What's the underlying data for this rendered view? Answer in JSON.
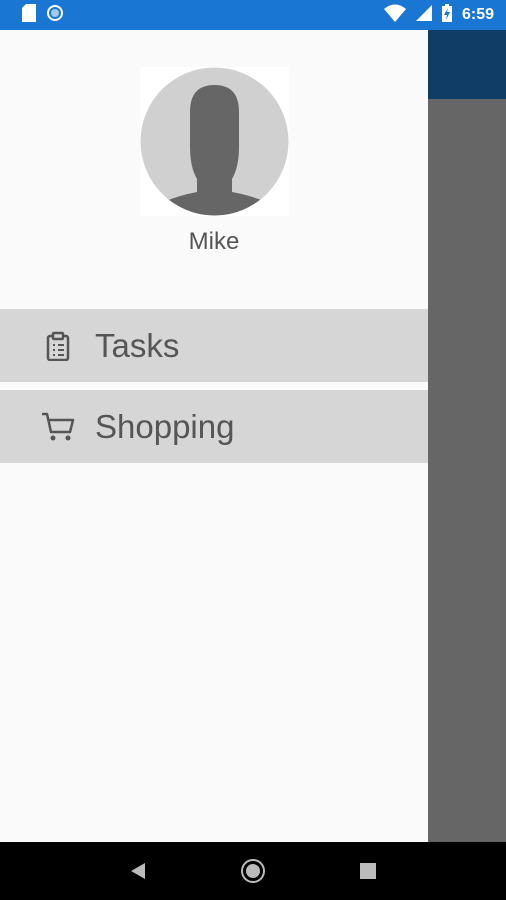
{
  "status_bar": {
    "time": "6:59",
    "icons": [
      "sd-card-icon",
      "sync-circle-icon",
      "wifi-icon",
      "signal-icon",
      "battery-charging-icon"
    ]
  },
  "drawer": {
    "user_name": "Mike",
    "menu": [
      {
        "label": "Tasks",
        "icon": "clipboard-icon"
      },
      {
        "label": "Shopping",
        "icon": "cart-icon"
      }
    ]
  },
  "nav_bar": {
    "buttons": [
      "back-icon",
      "home-icon",
      "recents-icon"
    ]
  },
  "colors": {
    "status_bar": "#1976d2",
    "toolbar": "#0f3d66",
    "menu_item_bg": "#d6d6d6",
    "scrim": "#666666"
  }
}
